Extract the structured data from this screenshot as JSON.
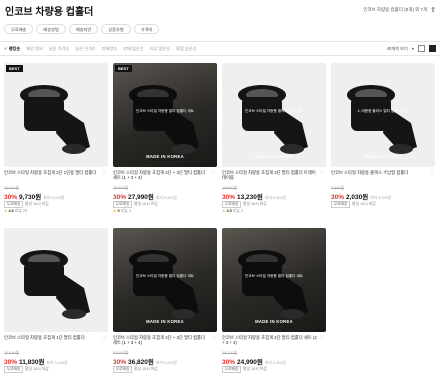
{
  "header": {
    "title": "인코브 차량용 컵홀더",
    "right_text": "인코브 차량용 컵홀더 (8개) 외 7개"
  },
  "filters": [
    "무료배송",
    "배송방법",
    "배송지연",
    "상품유형",
    "가격대"
  ],
  "sort": {
    "checked_label": "랭킹순",
    "options": [
      "랭킹순",
      "제안 정보",
      "낮은 가격순",
      "높은 가격순",
      "판매량순",
      "판매 많은순",
      "리뷰 많은순",
      "평점 높은순"
    ],
    "per_page": "40개씩 보기"
  },
  "products": [
    {
      "badge": "BEST",
      "overlay": "",
      "made": "",
      "name": "인코브 스타일 차량용 초집게 2단 1인용 멀티 컵홀더",
      "orig_price": "13,900원",
      "discount": "30%",
      "price": "9,730원",
      "sub": "최저 5,000원",
      "tag": "무료배송",
      "tag_sub": "평일 16시 마감",
      "rating": "4.6",
      "reviews": "리뷰 29",
      "theme": "light"
    },
    {
      "badge": "BEST",
      "overlay": "인코브 스타일 차량용 멀티 컵홀더 세트",
      "made": "MADE IN KOREA",
      "name": "인코브 스타일 차량용 초집게 2단 + 3단 멀티 컵홀더 세트 (1 + 3 + 4)",
      "orig_price": "39,900원",
      "discount": "30%",
      "price": "27,990원",
      "sub": "최저 5,000원",
      "tag": "무료배송",
      "tag_sub": "평일 16시 마감",
      "rating": "5",
      "reviews": "리뷰 3",
      "theme": "dark"
    },
    {
      "badge": "",
      "overlay": "인코브 스타일 차량용 멀티 컵홀더 세트",
      "made": "MADE IN KOREA",
      "name": "인코브 스타일 차량용 초집게 3단 멀티 컵홀더 트레이 테이블",
      "orig_price": "18,900원",
      "discount": "30%",
      "price": "13,230원",
      "sub": "최저 5,000원",
      "tag": "무료배송",
      "tag_sub": "평일 16시 마감",
      "rating": "4.5",
      "reviews": "리뷰 2",
      "theme": "light"
    },
    {
      "badge": "",
      "overlay": "4, 대용량 플러스 멀티 컵홀더 수납",
      "made": "MADE IN KOREA",
      "name": "인코브 스타일 차량용 플렉스 수납형 컵홀더",
      "orig_price": "2,900원",
      "discount": "30%",
      "price": "2,030원",
      "sub": "최저 5,000원",
      "tag": "무료배송",
      "tag_sub": "평일 16시 마감",
      "rating": "",
      "reviews": "",
      "theme": "light"
    },
    {
      "badge": "",
      "overlay": "",
      "made": "",
      "name": "인코브 스타일 차량용 초집게 1단 멀티 컵홀더",
      "orig_price": "16,900원",
      "discount": "30%",
      "price": "11,830원",
      "sub": "최저 5,000원",
      "tag": "무료배송",
      "tag_sub": "평일 16시 마감",
      "rating": "4.9",
      "reviews": "리뷰 35",
      "theme": "light"
    },
    {
      "badge": "",
      "overlay": "인코브 스타일 차량용 멀티 컵홀더 세트",
      "made": "MADE IN KOREA",
      "name": "인코브 스타일 차량용 초집게 2단 + 3단 멀티 컵홀더 세트 (1 + 3 + 4)",
      "orig_price": "52,600원",
      "discount": "30%",
      "price": "36,820원",
      "sub": "최저 5,000원",
      "tag": "무료배송",
      "tag_sub": "평일 16시 마감",
      "rating": "",
      "reviews": "",
      "theme": "dark"
    },
    {
      "badge": "",
      "overlay": "인코브 스타일 차량용 멀티 컵홀더 세트",
      "made": "MADE IN KOREA",
      "name": "인코브 스타일 차량용 초집게 2단 멀티 컵홀더 세트 (2 + 3 + 4)",
      "orig_price": "35,700원",
      "discount": "30%",
      "price": "24,990원",
      "sub": "최저 5,000원",
      "tag": "무료배송",
      "tag_sub": "평일 16시 마감",
      "rating": "",
      "reviews": "",
      "theme": "dark"
    }
  ],
  "colors": {
    "discount": "#e0322b",
    "star": "#ffae00"
  }
}
